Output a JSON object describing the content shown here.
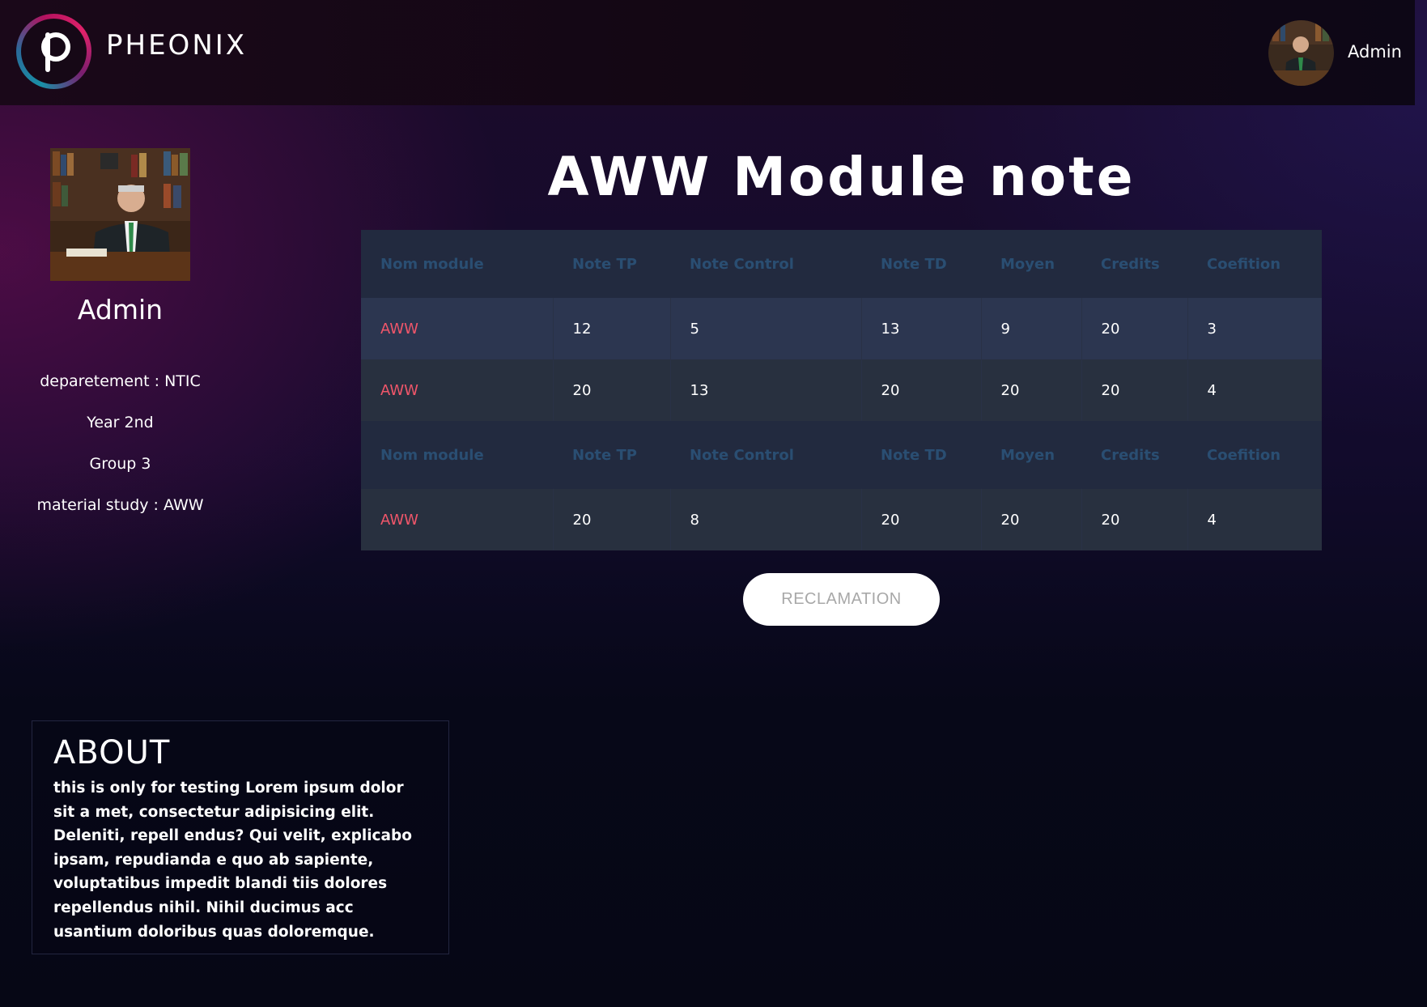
{
  "header": {
    "brand": "PHEONIX",
    "user_name": "Admin"
  },
  "profile": {
    "name": "Admin",
    "departement": "deparetement : NTIC",
    "year": "Year 2nd",
    "group": "Group 3",
    "material": "material study : AWW"
  },
  "page": {
    "title": "AWW Module note"
  },
  "table": {
    "headers": [
      "Nom module",
      "Note TP",
      "Note Control",
      "Note TD",
      "Moyen",
      "Credits",
      "Coefition"
    ],
    "rows": [
      [
        "AWW",
        "12",
        "5",
        "13",
        "9",
        "20",
        "3"
      ],
      [
        "AWW",
        "20",
        "13",
        "20",
        "20",
        "20",
        "4"
      ],
      [
        "AWW",
        "20",
        "8",
        "20",
        "20",
        "20",
        "4"
      ]
    ]
  },
  "actions": {
    "reclamation_label": "RECLAMATION"
  },
  "about": {
    "title": "ABOUT",
    "text": "this is only for testing Lorem ipsum dolor sit a met, consectetur adipisicing elit. Deleniti, repell endus? Qui velit, explicabo ipsam, repudianda e quo ab sapiente, voluptatibus impedit blandi tiis dolores repellendus nihil. Nihil ducimus acc usantium doloribus quas doloremque."
  },
  "colors": {
    "header_text": "#2a4e72",
    "module_name": "#f0566a",
    "row_dark": "#2c3650",
    "row_light": "#28303f"
  },
  "icons": {
    "logo": "pheonix-p-logo",
    "avatar": "user-portrait"
  }
}
